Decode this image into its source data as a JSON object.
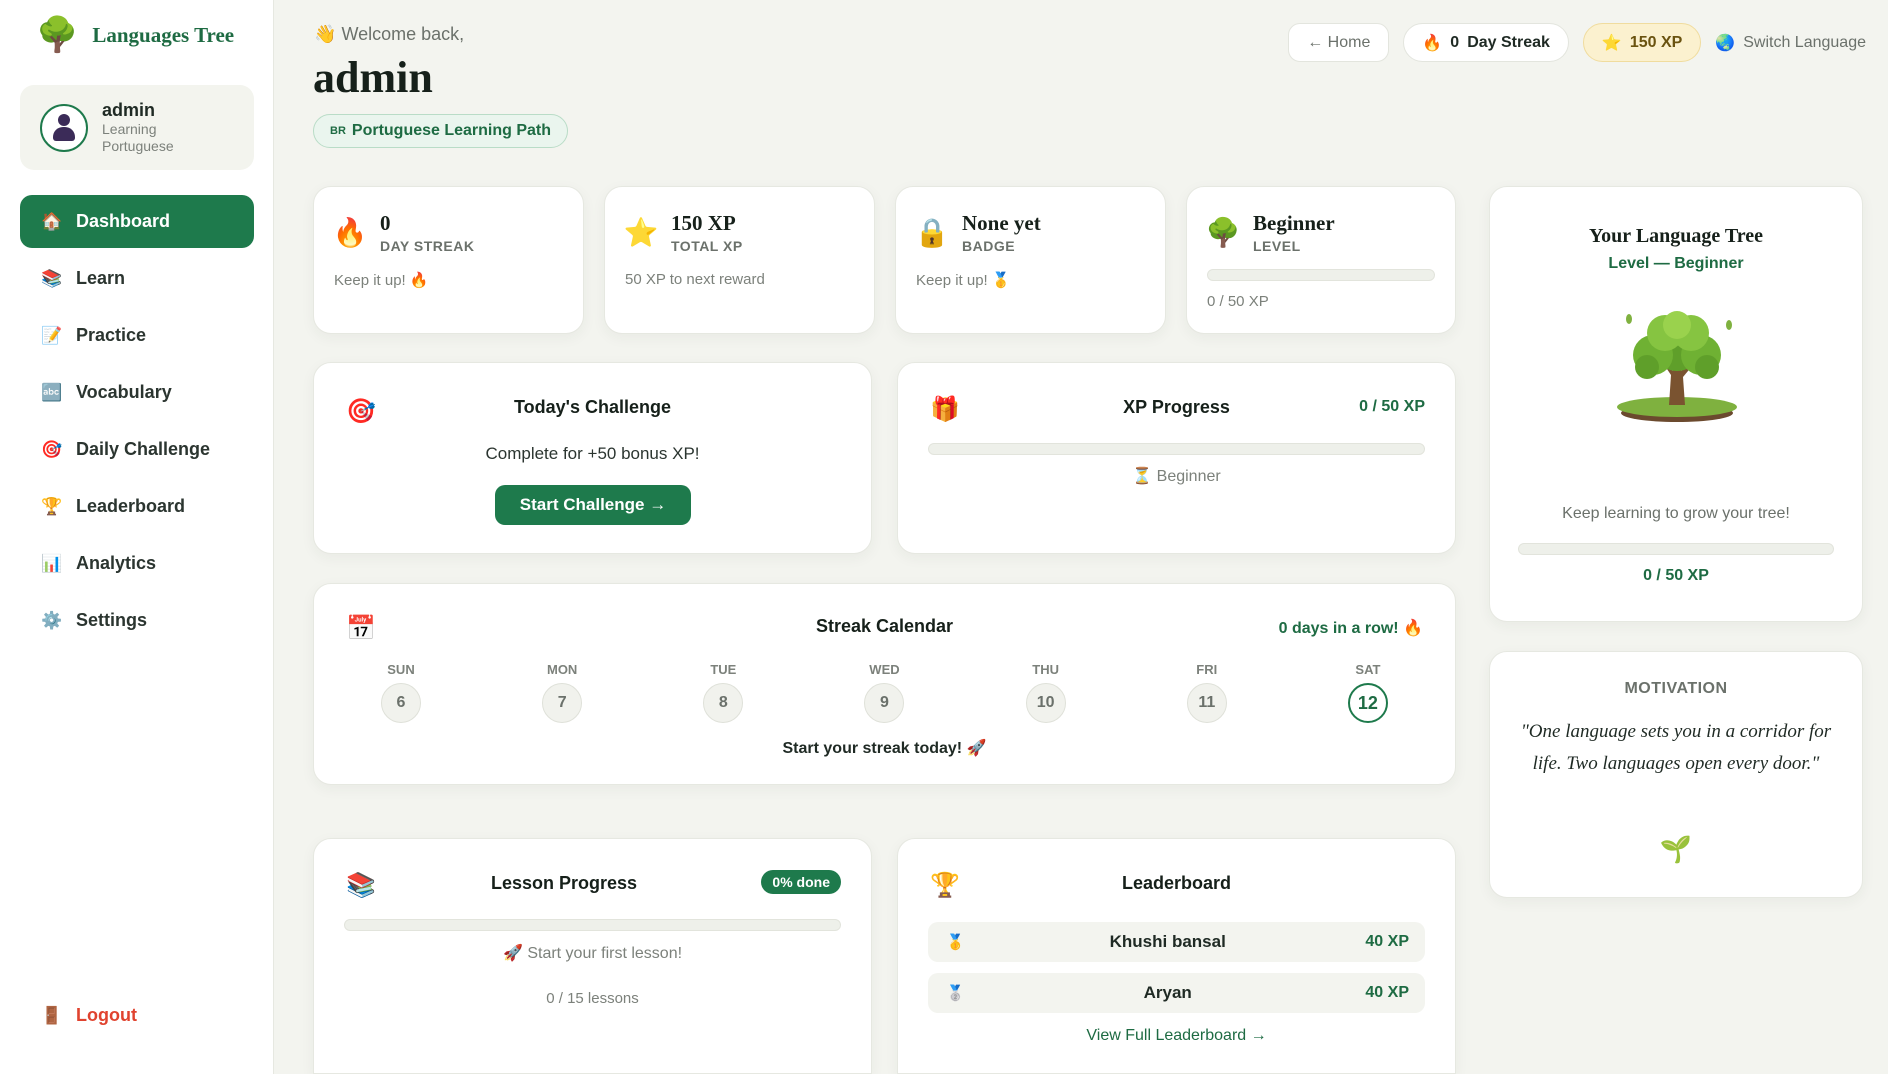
{
  "brand": {
    "name": "Languages Tree",
    "logo_icon": "tree-icon"
  },
  "user": {
    "name": "admin",
    "subtitle_line1": "Learning",
    "subtitle_line2": "Portuguese"
  },
  "nav": {
    "items": [
      {
        "label": "Dashboard",
        "icon": "house-icon",
        "active": true
      },
      {
        "label": "Learn",
        "icon": "books-icon"
      },
      {
        "label": "Practice",
        "icon": "memo-icon"
      },
      {
        "label": "Vocabulary",
        "icon": "abc-icon"
      },
      {
        "label": "Daily Challenge",
        "icon": "target-icon"
      },
      {
        "label": "Leaderboard",
        "icon": "trophy-icon"
      },
      {
        "label": "Analytics",
        "icon": "bar-chart-icon"
      },
      {
        "label": "Settings",
        "icon": "gear-icon"
      }
    ],
    "logout": "Logout"
  },
  "header": {
    "welcome": "Welcome back,",
    "title": "admin",
    "path_flag": "BR",
    "path": "Portuguese Learning Path",
    "home": "← Home",
    "streak_value": "0",
    "streak_label": "Day Streak",
    "xp": "150 XP",
    "switch_language": "Switch Language"
  },
  "stats": [
    {
      "value": "0",
      "label": "DAY STREAK",
      "foot": "Keep it up! 🔥",
      "icon": "fire-icon"
    },
    {
      "value": "150 XP",
      "label": "TOTAL XP",
      "foot": "50 XP to next reward",
      "icon": "star-icon"
    },
    {
      "value": "None yet",
      "label": "BADGE",
      "foot": "Keep it up! 🥇",
      "icon": "lock-icon"
    },
    {
      "value": "Beginner",
      "label": "LEVEL",
      "foot": "0 / 50 XP",
      "icon": "tree-icon",
      "progress": 0
    }
  ],
  "challenge": {
    "title": "Today's Challenge",
    "text": "Complete for +50 bonus XP!",
    "button": "Start Challenge →"
  },
  "xp_progress": {
    "title": "XP Progress",
    "value": "0 / 50 XP",
    "level": "Beginner",
    "progress": 0
  },
  "streak_calendar": {
    "title": "Streak Calendar",
    "status": "0 days in a row! 🔥",
    "days": [
      {
        "label": "SUN",
        "num": "6"
      },
      {
        "label": "MON",
        "num": "7"
      },
      {
        "label": "TUE",
        "num": "8"
      },
      {
        "label": "WED",
        "num": "9"
      },
      {
        "label": "THU",
        "num": "10"
      },
      {
        "label": "FRI",
        "num": "11"
      },
      {
        "label": "SAT",
        "num": "12",
        "today": true
      }
    ],
    "footer": "Start your streak today! 🚀"
  },
  "lesson_progress": {
    "title": "Lesson Progress",
    "badge": "0% done",
    "progress": 0,
    "hint": "🚀 Start your first lesson!",
    "count": "0 / 15 lessons"
  },
  "leaderboard": {
    "title": "Leaderboard",
    "rows": [
      {
        "name": "Khushi bansal",
        "xp": "40 XP",
        "medal": "gold-medal-icon"
      },
      {
        "name": "Aryan",
        "xp": "40 XP",
        "medal": "silver-medal-icon"
      }
    ],
    "link": "View Full Leaderboard →"
  },
  "tree_card": {
    "title": "Your Language Tree",
    "level": "Level — Beginner",
    "caption": "Keep learning to grow your tree!",
    "value": "0 / 50 XP",
    "progress": 0
  },
  "motivation": {
    "heading": "MOTIVATION",
    "quote": "\"One language sets you in a corridor for life. Two languages open every door.\"",
    "icon": "seedling-icon"
  },
  "colors": {
    "accent": "#1e7a4c",
    "background": "#f3f4ef",
    "logout": "#e0432f",
    "xp_pill": "#fbf1cf"
  }
}
